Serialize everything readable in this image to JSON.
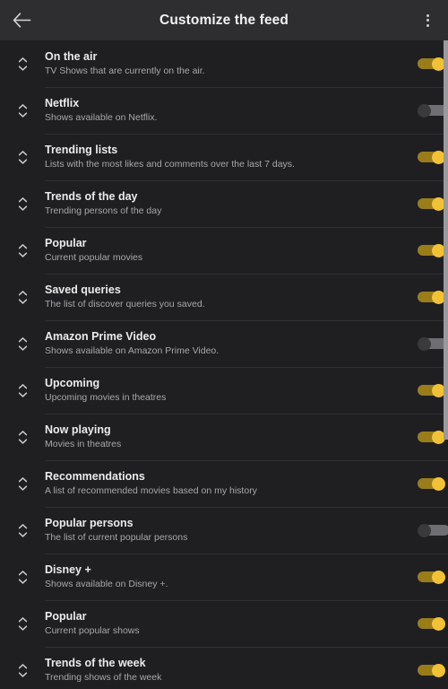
{
  "header": {
    "title": "Customize the feed",
    "back_icon": "arrow-left-icon",
    "menu_icon": "overflow-menu-icon"
  },
  "colors": {
    "accent_on_thumb": "#f2c236",
    "accent_on_track": "#9a7d18",
    "off_thumb": "#3a3a3d",
    "off_track": "#6e6e73",
    "appbar_bg": "#2e2e31",
    "list_bg": "#1f1f21",
    "page_bg": "#1b1b1d",
    "title_text": "#ebebec",
    "subtitle_text": "#a8a8ac",
    "divider": "#303033",
    "scrollbar": "#9a9a9e"
  },
  "list": {
    "handle_icon": "reorder-handle-icon",
    "items": [
      {
        "title": "On the air",
        "subtitle": "TV Shows that are currently on the air.",
        "enabled": true
      },
      {
        "title": "Netflix",
        "subtitle": "Shows available on Netflix.",
        "enabled": false
      },
      {
        "title": "Trending lists",
        "subtitle": "Lists with the most likes and comments over the last 7 days.",
        "enabled": true
      },
      {
        "title": "Trends of the day",
        "subtitle": "Trending persons of the day",
        "enabled": true
      },
      {
        "title": "Popular",
        "subtitle": "Current popular movies",
        "enabled": true
      },
      {
        "title": "Saved queries",
        "subtitle": "The list of discover queries you saved.",
        "enabled": true
      },
      {
        "title": "Amazon Prime Video",
        "subtitle": "Shows available on Amazon Prime Video.",
        "enabled": false
      },
      {
        "title": "Upcoming",
        "subtitle": "Upcoming movies in theatres",
        "enabled": true
      },
      {
        "title": "Now playing",
        "subtitle": "Movies in theatres",
        "enabled": true
      },
      {
        "title": "Recommendations",
        "subtitle": "A list of recommended movies based on my history",
        "enabled": true
      },
      {
        "title": "Popular persons",
        "subtitle": "The list of current popular persons",
        "enabled": false
      },
      {
        "title": "Disney +",
        "subtitle": "Shows available on Disney +.",
        "enabled": true
      },
      {
        "title": "Popular",
        "subtitle": "Current popular shows",
        "enabled": true
      },
      {
        "title": "Trends of the week",
        "subtitle": "Trending shows of the week",
        "enabled": true
      }
    ]
  },
  "scrollbar": {
    "name": "vertical-scrollbar"
  }
}
